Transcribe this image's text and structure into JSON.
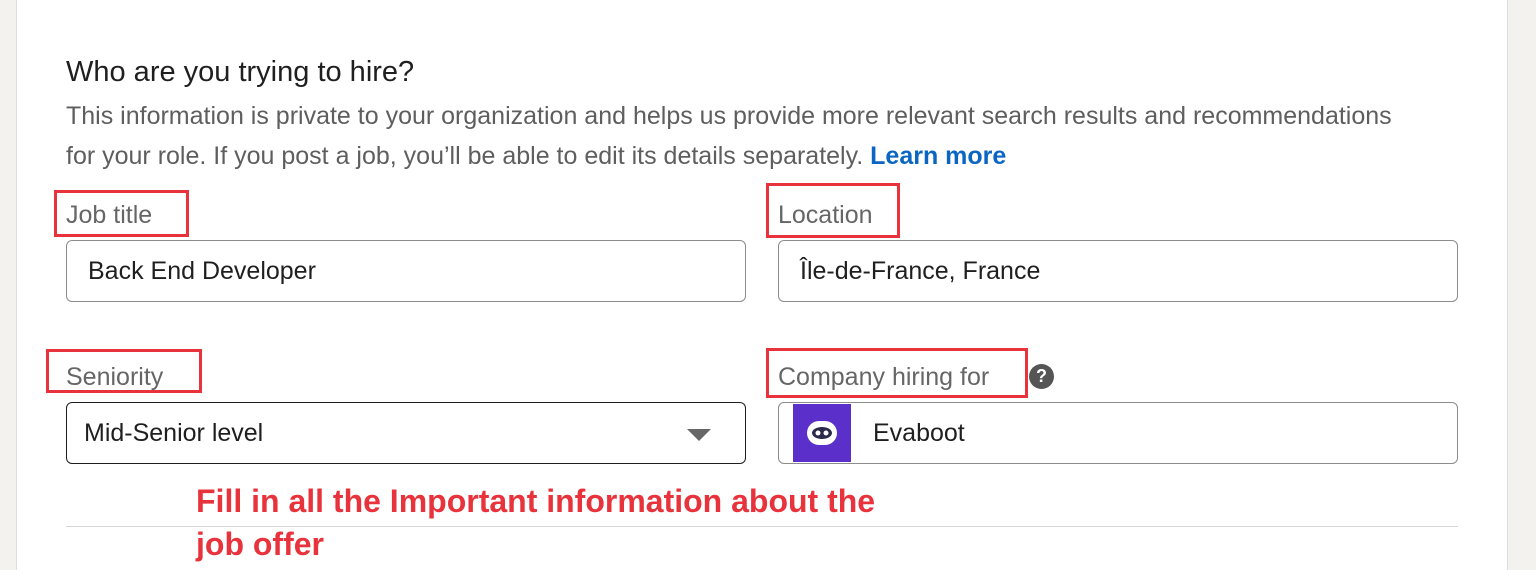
{
  "form": {
    "heading": "Who are you trying to hire?",
    "description": "This information is private to your organization and helps us provide more relevant search results and recommendations for your role. If you post a job, you’ll be able to edit its details separately.",
    "learn_more": "Learn more",
    "job_title": {
      "label": "Job title",
      "value": "Back End Developer"
    },
    "location": {
      "label": "Location",
      "value": "Île-de-France, France"
    },
    "seniority": {
      "label": "Seniority",
      "value": "Mid-Senior level"
    },
    "company": {
      "label": "Company hiring for",
      "value": "Evaboot",
      "help_icon": "?"
    }
  },
  "annotation": {
    "text": "Fill in all the Important information about the job offer",
    "color": "#e8333c"
  },
  "colors": {
    "link": "#0a66c2",
    "highlight": "#e8333c",
    "logo_bg": "#5b2fc9"
  },
  "icons": [
    "question-icon",
    "dropdown-caret-icon",
    "evaboot-logo-icon"
  ]
}
